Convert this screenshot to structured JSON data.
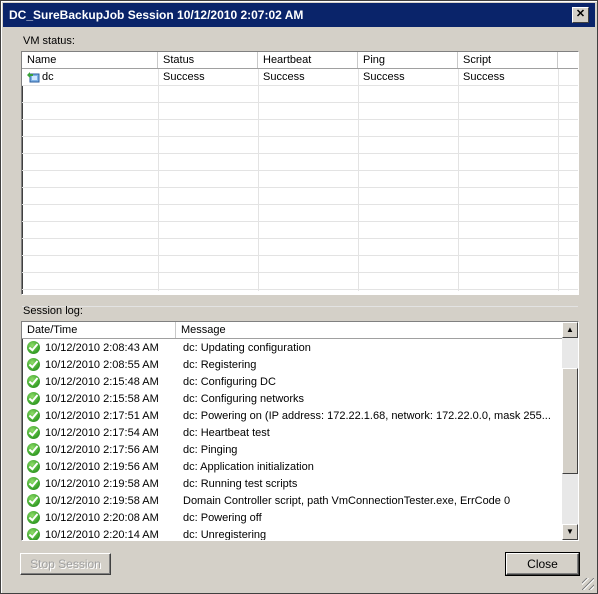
{
  "window": {
    "title": "DC_SureBackupJob Session 10/12/2010 2:07:02 AM",
    "close_glyph": "✕"
  },
  "vm_status": {
    "label": "VM status:",
    "columns": [
      "Name",
      "Status",
      "Heartbeat",
      "Ping",
      "Script"
    ],
    "rows": [
      {
        "name": "dc",
        "status": "Success",
        "heartbeat": "Success",
        "ping": "Success",
        "script": "Success"
      }
    ]
  },
  "session_log": {
    "label": "Session log:",
    "columns": [
      "Date/Time",
      "Message"
    ],
    "rows": [
      {
        "time": "10/12/2010 2:08:43 AM",
        "message": "dc: Updating configuration"
      },
      {
        "time": "10/12/2010 2:08:55 AM",
        "message": "dc: Registering"
      },
      {
        "time": "10/12/2010 2:15:48 AM",
        "message": "dc: Configuring DC"
      },
      {
        "time": "10/12/2010 2:15:58 AM",
        "message": "dc: Configuring networks"
      },
      {
        "time": "10/12/2010 2:17:51 AM",
        "message": "dc: Powering on (IP address: 172.22.1.68, network: 172.22.0.0, mask 255..."
      },
      {
        "time": "10/12/2010 2:17:54 AM",
        "message": "dc: Heartbeat test"
      },
      {
        "time": "10/12/2010 2:17:56 AM",
        "message": "dc: Pinging"
      },
      {
        "time": "10/12/2010 2:19:56 AM",
        "message": "dc: Application initialization"
      },
      {
        "time": "10/12/2010 2:19:58 AM",
        "message": "dc: Running test scripts"
      },
      {
        "time": "10/12/2010 2:19:58 AM",
        "message": "Domain Controller script, path VmConnectionTester.exe, ErrCode 0"
      },
      {
        "time": "10/12/2010 2:20:08 AM",
        "message": "dc: Powering off"
      },
      {
        "time": "10/12/2010 2:20:14 AM",
        "message": "dc: Unregistering"
      }
    ]
  },
  "buttons": {
    "stop_session": "Stop Session",
    "close": "Close"
  },
  "colors": {
    "titlebar": "#0a246a",
    "success_icon": "#3da52c",
    "dialog_bg": "#d4d0c8"
  }
}
